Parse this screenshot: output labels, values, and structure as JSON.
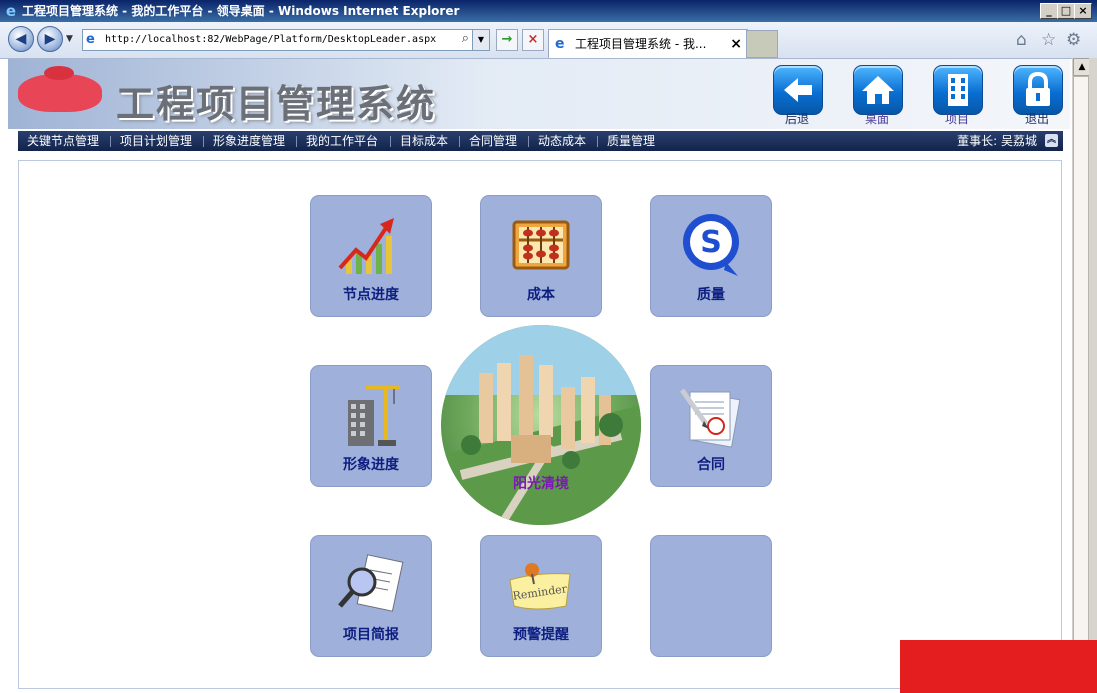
{
  "window": {
    "title": "工程项目管理系统 - 我的工作平台 - 领导桌面 - Windows Internet Explorer",
    "controls": {
      "minimize": "_",
      "maximize": "□",
      "close": "×"
    }
  },
  "browser": {
    "address_url": "http://localhost:82/WebPage/Platform/DesktopLeader.aspx",
    "tab_title": "工程项目管理系统 - 我...",
    "tab_close": "×"
  },
  "header": {
    "app_title": "工程项目管理系统",
    "icons": [
      {
        "label": "后退",
        "icon": "back-arrow-icon"
      },
      {
        "label": "桌面",
        "icon": "home-icon"
      },
      {
        "label": "项目",
        "icon": "building-icon"
      },
      {
        "label": "退出",
        "icon": "lock-icon"
      }
    ]
  },
  "menu": {
    "items": [
      "关键节点管理",
      "项目计划管理",
      "形象进度管理",
      "我的工作平台",
      "目标成本",
      "合同管理",
      "动态成本",
      "质量管理"
    ],
    "user": "董事长: 吴荔城"
  },
  "tiles": [
    {
      "label": "节点进度",
      "icon": "growth-chart-icon"
    },
    {
      "label": "成本",
      "icon": "abacus-icon"
    },
    {
      "label": "质量",
      "icon": "quality-s-icon"
    },
    {
      "label": "形象进度",
      "icon": "construction-icon"
    },
    {
      "label": "合同",
      "icon": "contract-document-icon"
    },
    {
      "label": "项目简报",
      "icon": "magnifier-report-icon"
    },
    {
      "label": "预警提醒",
      "icon": "reminder-note-icon"
    },
    {
      "label": "",
      "icon": ""
    }
  ],
  "hub": {
    "label": "阳光清境"
  },
  "colors": {
    "menu_bar": "#1b2f5c",
    "tile": "#9fb0da",
    "tile_text": "#0e1e80",
    "header_icon": "#0a6fd2"
  }
}
